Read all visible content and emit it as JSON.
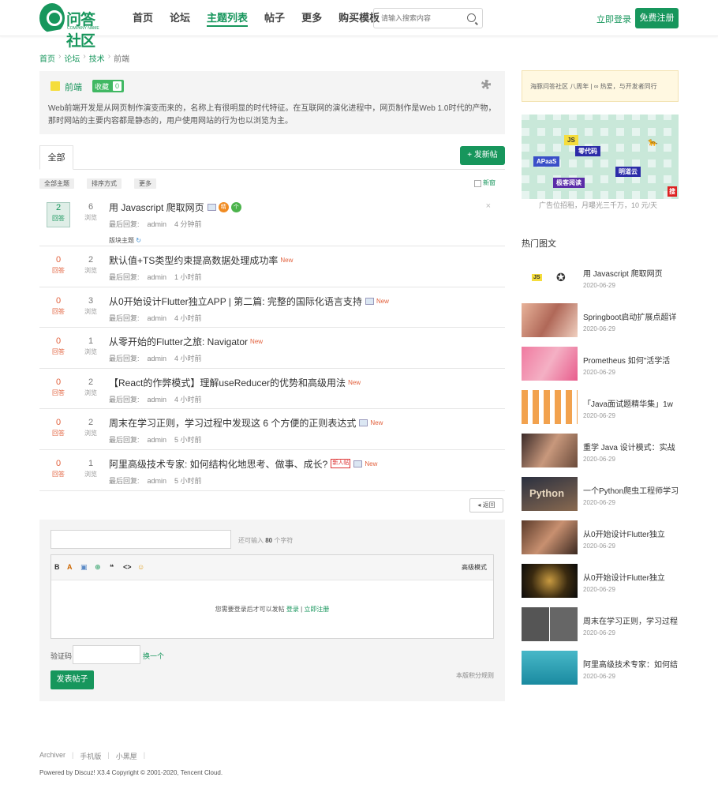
{
  "header": {
    "logo_text": "问答社区",
    "logo_sub": "COMPANY NAME",
    "nav": [
      "首页",
      "论坛",
      "主题列表",
      "帖子",
      "更多",
      "购买模板"
    ],
    "search_placeholder": "请输入搜索内容",
    "login": "立即登录",
    "register": "免费注册"
  },
  "breadcrumb": [
    "首页",
    "论坛",
    "技术",
    "前端"
  ],
  "forum": {
    "name": "前端",
    "fav_label": "收藏",
    "fav_count": "0",
    "desc": "Web前端开发是从网页制作演变而来的，名称上有很明显的时代特征。在互联网的演化进程中，网页制作是Web 1.0时代的产物，那时网站的主要内容都是静态的，用户使用网站的行为也以浏览为主。"
  },
  "tabs": {
    "all": "全部",
    "new_post": "+ 发新帖"
  },
  "filters": {
    "all_topics": "全部主题",
    "sort": "排序方式",
    "more": "更多",
    "new_window": "新窗"
  },
  "reply_label": "回答",
  "view_label": "浏览",
  "last_reply_label": "最后回复:",
  "threads": [
    {
      "replies": "2",
      "views": "6",
      "title": "用 Javascript 爬取网页",
      "author": "admin",
      "time": "4 分钟前",
      "sub": "版块主题",
      "hot1": "精",
      "hot2": "个"
    },
    {
      "replies": "0",
      "views": "2",
      "title": "默认值+TS类型约束提高数据处理成功率",
      "author": "admin",
      "time": "1 小时前",
      "new": "New"
    },
    {
      "replies": "0",
      "views": "3",
      "title": "从0开始设计Flutter独立APP | 第二篇: 完整的国际化语言支持",
      "author": "admin",
      "time": "4 小时前",
      "new": "New"
    },
    {
      "replies": "0",
      "views": "1",
      "title": "从零开始的Flutter之旅: Navigator",
      "author": "admin",
      "time": "4 小时前",
      "new": "New"
    },
    {
      "replies": "0",
      "views": "2",
      "title": "【React的作弊模式】理解useReducer的优势和高级用法",
      "author": "admin",
      "time": "4 小时前",
      "new": "New"
    },
    {
      "replies": "0",
      "views": "2",
      "title": "周末在学习正则，学习过程中发现这 6 个方便的正则表达式",
      "author": "admin",
      "time": "5 小时前",
      "new": "New"
    },
    {
      "replies": "0",
      "views": "1",
      "title": "阿里高级技术专家: 如何结构化地思考、做事、成长?",
      "author": "admin",
      "time": "5 小时前",
      "badge": "新人帖",
      "new": "New"
    }
  ],
  "back": "返回",
  "reply": {
    "remain_pre": "还可输入",
    "remain_num": "80",
    "remain_post": "个字符",
    "toolbar": [
      "B",
      "A",
      "▣",
      "⊕",
      "❝",
      "<>",
      "☺"
    ],
    "advanced": "高级模式",
    "login_msg": "您需要登录后才可以发帖",
    "login_link": "登录",
    "separator": "|",
    "register_link": "立即注册",
    "captcha_label": "验证码",
    "captcha_change": "换一个",
    "rules": "本版积分规则",
    "submit": "发表帖子"
  },
  "sidebar": {
    "notice": "海豚问答社区 八周年 | ∞ 热爱，与开发者同行",
    "ad_tags": [
      "JS",
      "零代码",
      "APaaS",
      "明道云",
      "极客阅读",
      "搜"
    ],
    "ad_caption": "广告位招租，月曝光三千万，10 元/天",
    "hot_title": "热门图文",
    "hot": [
      {
        "title": "用 Javascript 爬取网页",
        "date": "2020-06-29"
      },
      {
        "title": "Springboot启动扩展点超详",
        "date": "2020-06-29"
      },
      {
        "title": "Prometheus 如何\"活学活",
        "date": "2020-06-29"
      },
      {
        "title": "「Java面试题精华集」1w",
        "date": "2020-06-29"
      },
      {
        "title": "重学 Java 设计模式：实战",
        "date": "2020-06-29"
      },
      {
        "title": "一个Python爬虫工程师学习",
        "date": "2020-06-29"
      },
      {
        "title": "从0开始设计Flutter独立",
        "date": "2020-06-29"
      },
      {
        "title": "从0开始设计Flutter独立",
        "date": "2020-06-29"
      },
      {
        "title": "周末在学习正则，学习过程",
        "date": "2020-06-29"
      },
      {
        "title": "阿里高级技术专家：如何结",
        "date": "2020-06-29"
      }
    ],
    "python_text": "Python"
  },
  "footer": {
    "links": [
      "Archiver",
      "手机版",
      "小黑屋"
    ],
    "separator": "|",
    "copyright": "Powered by Discuz! X3.4 Copyright © 2001-2020, Tencent Cloud."
  },
  "colors": {
    "brand": "#17965c",
    "new": "#e2613d"
  }
}
